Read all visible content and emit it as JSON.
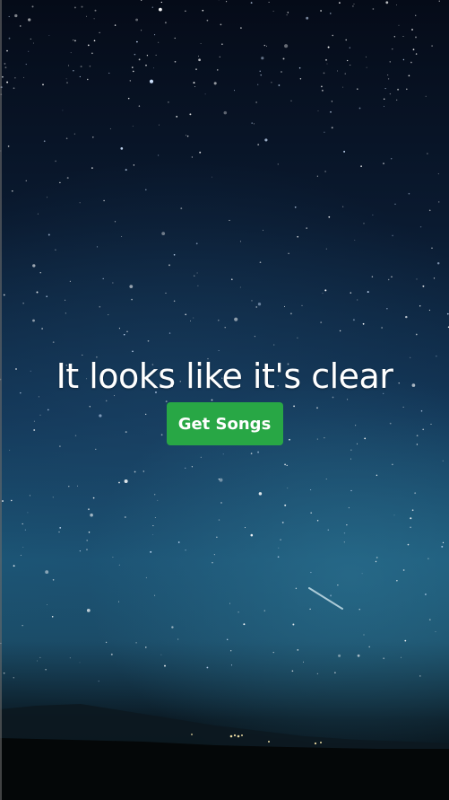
{
  "main": {
    "headline": "It looks like it's clear",
    "get_songs_label": "Get Songs"
  },
  "colors": {
    "button_background": "#28a745",
    "headline_text": "#ffffff",
    "sky_top": "#050b18",
    "sky_horizon": "#1c5878"
  }
}
